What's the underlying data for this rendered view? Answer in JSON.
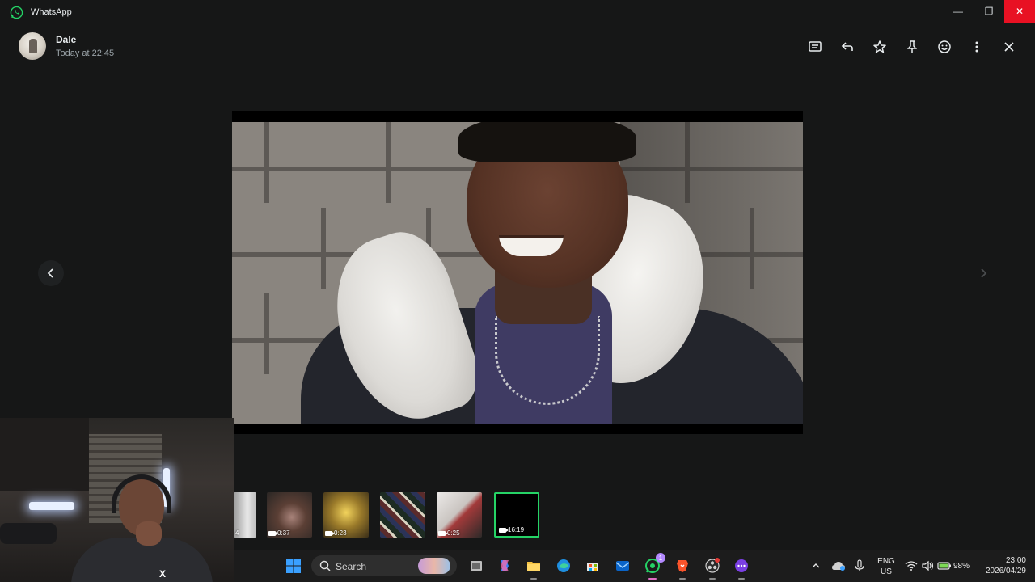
{
  "window": {
    "app_title": "WhatsApp",
    "minimize_label": "—",
    "maximize_label": "❐",
    "close_label": "✕"
  },
  "viewer": {
    "sender_name": "Dale",
    "sender_time": "Today at 22:45",
    "header_icons": [
      "message-icon",
      "reply-icon",
      "star-icon",
      "pin-icon",
      "emoji-icon",
      "more-icon",
      "close-icon"
    ]
  },
  "thumbnails": [
    {
      "duration": "",
      "kind": "image"
    },
    {
      "duration": "0:37",
      "kind": "video"
    },
    {
      "duration": "0:23",
      "kind": "video"
    },
    {
      "duration": "",
      "kind": "image"
    },
    {
      "duration": "0:25",
      "kind": "video"
    },
    {
      "duration": "16:19",
      "kind": "video",
      "selected": true
    }
  ],
  "thumb_first_partial_label": "4",
  "taskbar": {
    "search_label": "Search",
    "whatsapp_badge": "1",
    "lang_line1": "ENG",
    "lang_line2": "US",
    "battery": "98%",
    "time": "23:00",
    "date": "2026/04/29"
  },
  "colors": {
    "accent_green": "#25d366",
    "close_red": "#e81123",
    "background": "#161717"
  }
}
